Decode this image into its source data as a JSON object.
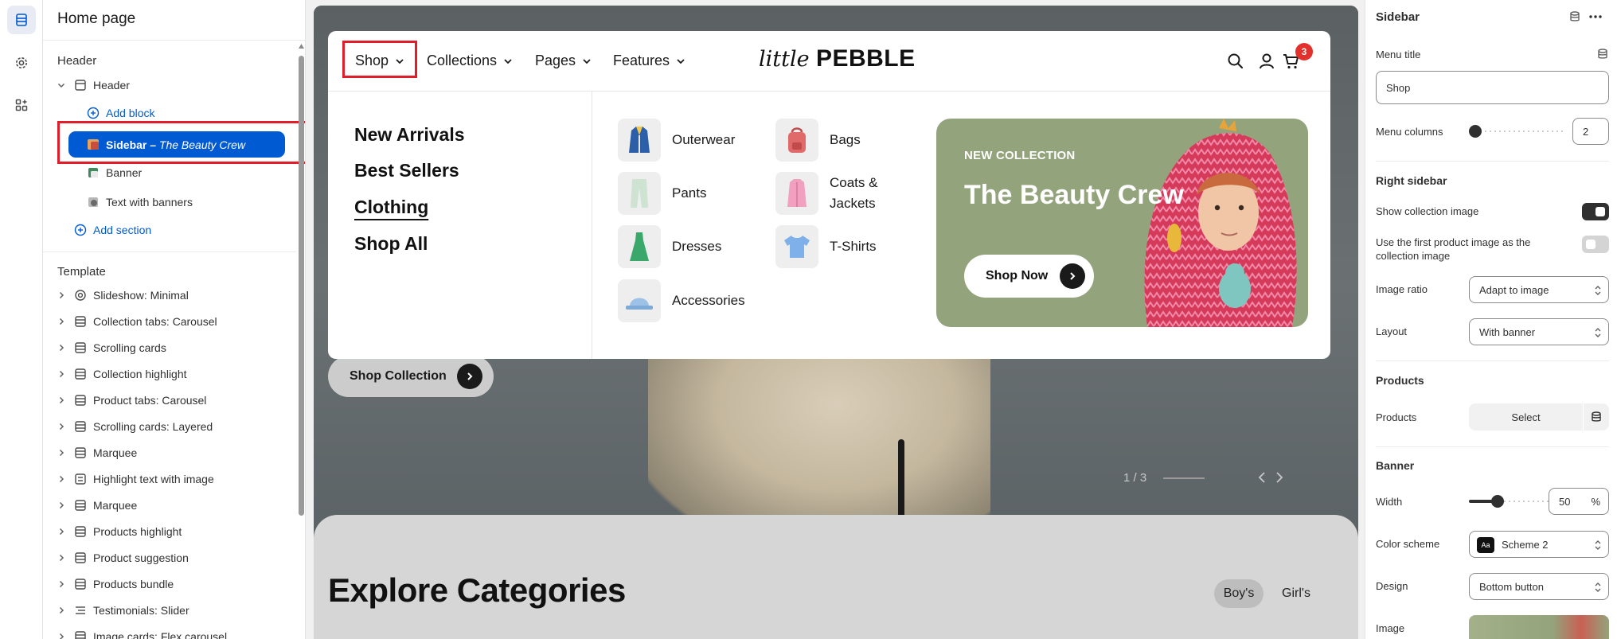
{
  "left_panel": {
    "title": "Home page",
    "header_section_label": "Header",
    "header_item": "Header",
    "add_block": "Add block",
    "selected_item": {
      "prefix": "Sidebar – ",
      "name": "The Beauty Crew"
    },
    "banner_item": "Banner",
    "text_with_banners_item": "Text with banners",
    "add_section": "Add section",
    "template_label": "Template",
    "template_items": [
      "Slideshow: Minimal",
      "Collection tabs: Carousel",
      "Scrolling cards",
      "Collection highlight",
      "Product tabs: Carousel",
      "Scrolling cards: Layered",
      "Marquee",
      "Highlight text with image",
      "Marquee",
      "Products highlight",
      "Product suggestion",
      "Products bundle",
      "Testimonials: Slider",
      "Image cards: Flex carousel"
    ]
  },
  "preview": {
    "nav": {
      "items": [
        "Shop",
        "Collections",
        "Pages",
        "Features"
      ],
      "logo_script": "little",
      "logo_bold": "PEBBLE",
      "cart_count": "3"
    },
    "menu_links": [
      "New Arrivals",
      "Best Sellers",
      "Clothing",
      "Shop All"
    ],
    "categories_col1": [
      "Outerwear",
      "Pants",
      "Dresses",
      "Accessories"
    ],
    "categories_col2": [
      "Bags",
      "Coats & Jackets",
      "T-Shirts"
    ],
    "banner": {
      "kicker": "NEW COLLECTION",
      "title": "The Beauty Crew",
      "button": "Shop Now"
    },
    "hero_button": "Shop Collection",
    "pager": "1 / 3",
    "explore_title": "Explore Categories",
    "tabs": [
      "Boy's",
      "Girl's"
    ]
  },
  "right_panel": {
    "title": "Sidebar",
    "menu_title_label": "Menu title",
    "menu_title_value": "Shop",
    "menu_columns_label": "Menu columns",
    "menu_columns_value": "2",
    "right_sidebar_heading": "Right sidebar",
    "show_collection_image_label": "Show collection image",
    "show_collection_image": true,
    "first_product_label": "Use the first product image as the collection image",
    "first_product_image": false,
    "image_ratio_label": "Image ratio",
    "image_ratio_value": "Adapt to image",
    "layout_label": "Layout",
    "layout_value": "With banner",
    "products_heading": "Products",
    "products_label": "Products",
    "products_button": "Select",
    "banner_heading": "Banner",
    "width_label": "Width",
    "width_value": "50",
    "width_unit": "%",
    "color_scheme_label": "Color scheme",
    "color_scheme_swatch": "Aa",
    "color_scheme_value": "Scheme 2",
    "design_label": "Design",
    "design_value": "Bottom button",
    "image_label": "Image"
  },
  "colors": {
    "accent_blue": "#005bd3",
    "highlight_red": "#e11d2a",
    "banner_green": "#93a37b",
    "cart_badge": "#e2312c"
  }
}
